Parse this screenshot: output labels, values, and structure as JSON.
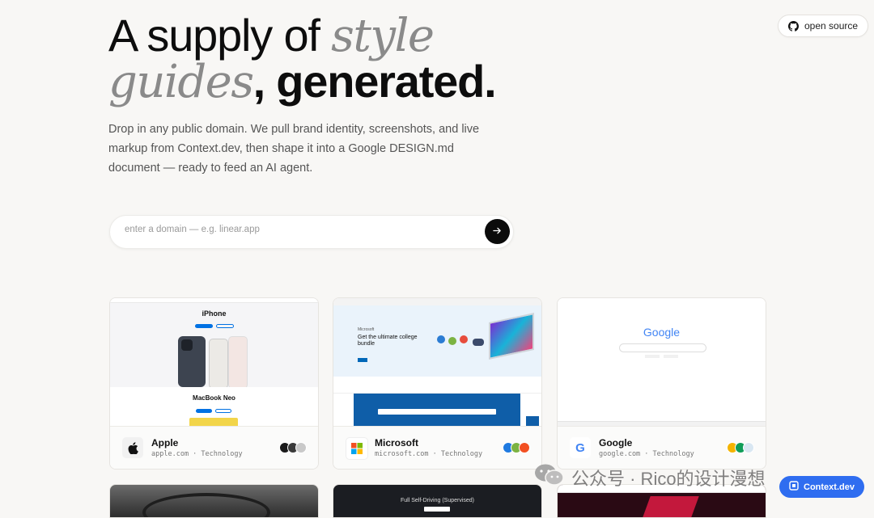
{
  "header": {
    "open_source_label": "open source"
  },
  "hero": {
    "line1_regular": "A supply of",
    "line1_italic": "style",
    "line2_italic": "guides",
    "line2_regular": ", generated.",
    "subtitle": "Drop in any public domain. We pull brand identity, screenshots, and live markup from Context.dev, then shape it into a Google DESIGN.md document — ready to feed an AI agent."
  },
  "search": {
    "placeholder": "enter a domain — e.g. linear.app",
    "value": ""
  },
  "cards": [
    {
      "name": "Apple",
      "domain": "apple.com",
      "category": "Technology",
      "swatches": [
        "#1a1a1a",
        "#3a3a3a",
        "#c9c9c9"
      ],
      "thumb": {
        "h1": "iPhone",
        "h2": "MacBook Neo"
      }
    },
    {
      "name": "Microsoft",
      "domain": "microsoft.com",
      "category": "Technology",
      "swatches": [
        "#1f7ae0",
        "#7cb342",
        "#f25022"
      ],
      "thumb": {
        "h1": "Get the ultimate college bundle",
        "brand": "Microsoft"
      }
    },
    {
      "name": "Google",
      "domain": "google.com",
      "category": "Technology",
      "swatches": [
        "#f4b400",
        "#0f9d58",
        "#d9e7f2"
      ],
      "thumb": {
        "brand": "Google"
      }
    }
  ],
  "bottom_row": {
    "second_card_caption": "Full Self-Driving (Supervised)"
  },
  "badge": {
    "label": "Context.dev"
  },
  "watermark": {
    "text": "公众号 · Rico的设计漫想"
  },
  "colors": {
    "background": "#f8f7f5",
    "accent": "#2f6df0",
    "ink": "#0d0d0d"
  }
}
